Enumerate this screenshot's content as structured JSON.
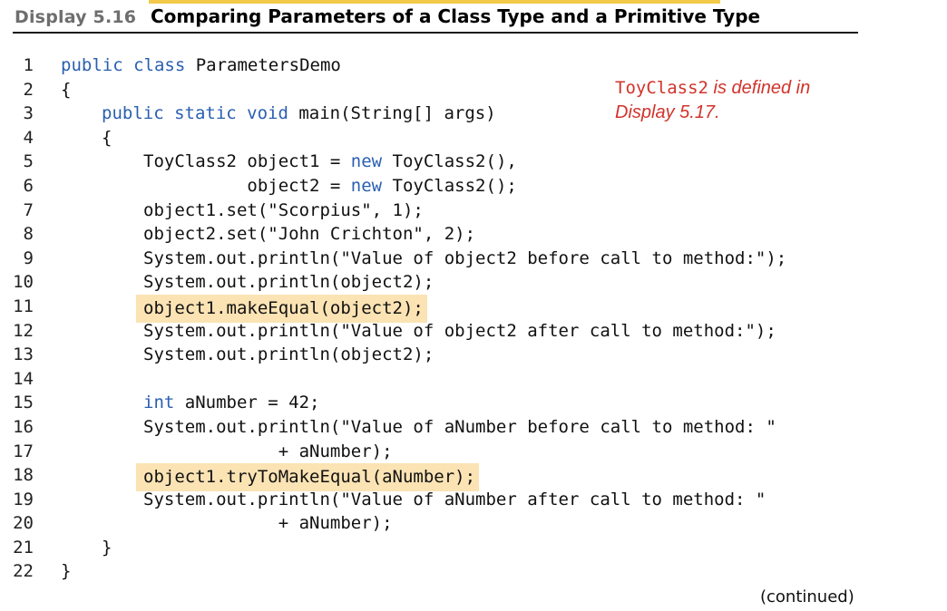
{
  "header": {
    "display_label": "Display 5.16",
    "title": "Comparing Parameters of a Class Type and a Primitive Type"
  },
  "code_lines": [
    {
      "n": "1",
      "indent": 0,
      "segments": [
        {
          "t": "public class ",
          "k": true
        },
        {
          "t": "ParametersDemo"
        }
      ]
    },
    {
      "n": "2",
      "indent": 0,
      "segments": [
        {
          "t": "{"
        }
      ]
    },
    {
      "n": "3",
      "indent": 1,
      "segments": [
        {
          "t": "public static void ",
          "k": true
        },
        {
          "t": "main(String[] args)"
        }
      ]
    },
    {
      "n": "4",
      "indent": 1,
      "segments": [
        {
          "t": "{"
        }
      ]
    },
    {
      "n": "5",
      "indent": 2,
      "segments": [
        {
          "t": "ToyClass2 object1 = "
        },
        {
          "t": "new",
          "k": true
        },
        {
          "t": " ToyClass2(),"
        }
      ]
    },
    {
      "n": "6",
      "indent": 2,
      "segments": [
        {
          "t": "          object2 = "
        },
        {
          "t": "new",
          "k": true
        },
        {
          "t": " ToyClass2();"
        }
      ]
    },
    {
      "n": "7",
      "indent": 2,
      "segments": [
        {
          "t": "object1.set(\"Scorpius\", 1);"
        }
      ]
    },
    {
      "n": "8",
      "indent": 2,
      "segments": [
        {
          "t": "object2.set(\"John Crichton\", 2);"
        }
      ]
    },
    {
      "n": "9",
      "indent": 2,
      "segments": [
        {
          "t": "System.out.println(\"Value of object2 before call to method:\");"
        }
      ]
    },
    {
      "n": "10",
      "indent": 2,
      "segments": [
        {
          "t": "System.out.println(object2);"
        }
      ]
    },
    {
      "n": "11",
      "indent": 2,
      "highlight": true,
      "segments": [
        {
          "t": "object1.makeEqual(object2);"
        }
      ]
    },
    {
      "n": "12",
      "indent": 2,
      "segments": [
        {
          "t": "System.out.println(\"Value of object2 after call to method:\");"
        }
      ]
    },
    {
      "n": "13",
      "indent": 2,
      "segments": [
        {
          "t": "System.out.println(object2);"
        }
      ]
    },
    {
      "n": "14",
      "indent": 0,
      "segments": []
    },
    {
      "n": "15",
      "indent": 2,
      "segments": [
        {
          "t": "int",
          "k": true
        },
        {
          "t": " aNumber = 42;"
        }
      ]
    },
    {
      "n": "16",
      "indent": 2,
      "segments": [
        {
          "t": "System.out.println(\"Value of aNumber before call to method: \""
        }
      ]
    },
    {
      "n": "17",
      "indent": 2,
      "segments": [
        {
          "t": "             + aNumber);"
        }
      ]
    },
    {
      "n": "18",
      "indent": 2,
      "highlight": true,
      "segments": [
        {
          "t": "object1.tryToMakeEqual(aNumber);"
        }
      ]
    },
    {
      "n": "19",
      "indent": 2,
      "segments": [
        {
          "t": "System.out.println(\"Value of aNumber after call to method: \""
        }
      ]
    },
    {
      "n": "20",
      "indent": 2,
      "segments": [
        {
          "t": "             + aNumber);"
        }
      ]
    },
    {
      "n": "21",
      "indent": 1,
      "segments": [
        {
          "t": "}"
        }
      ]
    },
    {
      "n": "22",
      "indent": 0,
      "segments": [
        {
          "t": "}"
        }
      ]
    }
  ],
  "annotation": {
    "code_part": "ToyClass2",
    "text_part": " is defined in",
    "line2": "Display 5.17."
  },
  "footer": {
    "continued": "(continued)"
  },
  "colors": {
    "keyword": "#2a5fb0",
    "highlight": "#fbe3b4",
    "annotation": "#d2332b",
    "accent": "#f3c94c"
  }
}
